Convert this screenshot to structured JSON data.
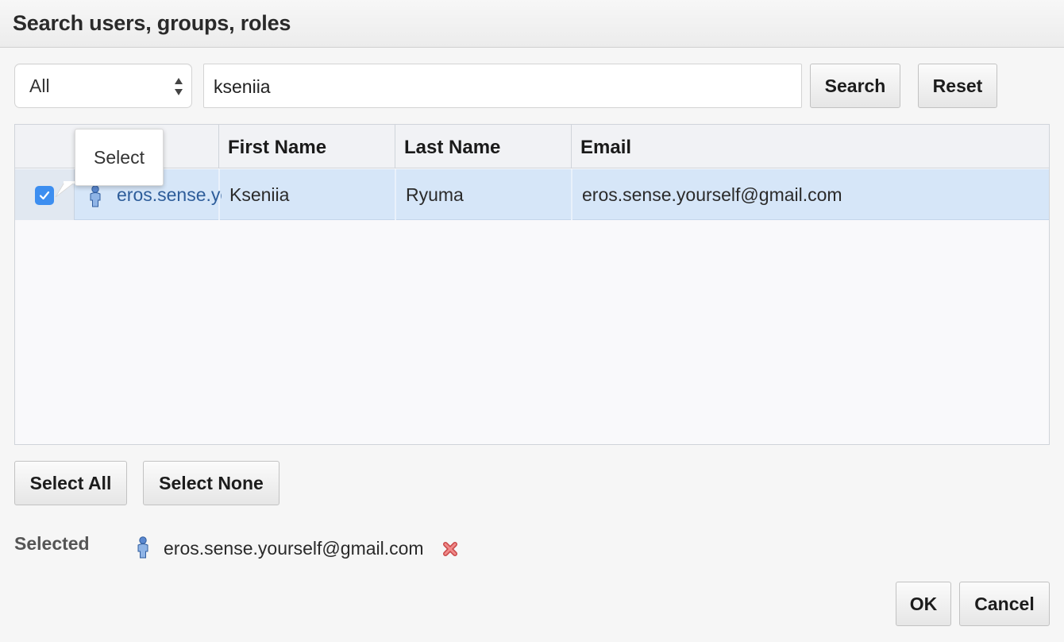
{
  "dialog": {
    "title": "Search users, groups, roles"
  },
  "search": {
    "type_filter": "All",
    "query": "kseniia",
    "search_button": "Search",
    "reset_button": "Reset"
  },
  "table": {
    "headers": [
      "",
      "First Name",
      "Last Name",
      "Email"
    ],
    "rows": [
      {
        "checked": true,
        "username": "eros.sense.yourself@gmail.com",
        "first_name": "Kseniia",
        "last_name": "Ryuma",
        "email": "eros.sense.yourself@gmail.com"
      }
    ]
  },
  "tooltip": {
    "text": "Select"
  },
  "selection": {
    "select_all_button": "Select All",
    "select_none_button": "Select None",
    "label": "Selected",
    "items": [
      {
        "value": "eros.sense.yourself@gmail.com"
      }
    ]
  },
  "footer": {
    "ok_button": "OK",
    "cancel_button": "Cancel"
  },
  "colors": {
    "row_selected": "#d6e6f8",
    "checkbox": "#3d8ef0",
    "link": "#2e5d9a",
    "remove_icon": "#e05a5a",
    "user_icon": "#4a78c0"
  }
}
